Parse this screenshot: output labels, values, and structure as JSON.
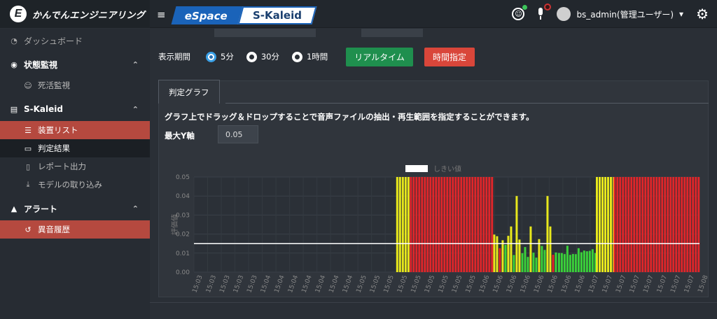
{
  "brand": {
    "logo_letter": "E",
    "name": "かんでんエンジニアリング"
  },
  "header": {
    "hamburger_glyph": "≡",
    "product_left": "eSpace",
    "product_right": "S-Kaleid",
    "smile_glyph": "☺",
    "user_name": "bs_admin(管理ユーザー)",
    "user_caret": "▾",
    "gear_glyph": "⚙"
  },
  "sidebar": {
    "dashboard": "ダッシュボード",
    "status_section": "状態監視",
    "status_items": [
      "死活監視"
    ],
    "skaleid_section": "S-Kaleid",
    "skaleid_items": [
      "装置リスト",
      "判定結果",
      "レポート出力",
      "モデルの取り込み"
    ],
    "alert_section": "アラート",
    "alert_items": [
      "異音履歴"
    ]
  },
  "controls": {
    "period_label": "表示期間",
    "options": [
      "5分",
      "30分",
      "1時間"
    ],
    "selected": "5分",
    "realtime_button": "リアルタイム",
    "time_button": "時間指定"
  },
  "panel": {
    "tab_label": "判定グラフ",
    "instruction": "グラフ上でドラッグ＆ドロップすることで音声ファイルの抽出・再生範囲を指定することができます。",
    "ymax_label": "最大Y軸",
    "ymax_value": "0.05"
  },
  "colors": {
    "red": "#e0262a",
    "yellow": "#e8e81c",
    "green": "#3ad13a",
    "threshold": "#ffffff"
  },
  "chart_data": {
    "type": "bar",
    "legend": [
      "しきい値"
    ],
    "ylabel": "評価値",
    "ylim": [
      0,
      0.05
    ],
    "yticks": [
      "0.05",
      "0.04",
      "0.03",
      "0.02",
      "0.01",
      "0.00"
    ],
    "threshold": 0.015,
    "xticks": [
      "15:03",
      "15:03",
      "15:03",
      "15:03",
      "15:03",
      "15:04",
      "15:04",
      "15:04",
      "15:04",
      "15:04",
      "15:04",
      "15:04",
      "15:05",
      "15:05",
      "15:05",
      "15:05",
      "15:05",
      "15:05",
      "15:05",
      "15:05",
      "15:05",
      "15:06",
      "15:06",
      "15:06",
      "15:06",
      "15:06",
      "15:06",
      "15:06",
      "15:06",
      "15:07",
      "15:07",
      "15:07",
      "15:07",
      "15:07",
      "15:07",
      "15:07",
      "15:07",
      "15:08"
    ],
    "segments": [
      {
        "from": 0.4,
        "to": 0.427,
        "color": "yellow",
        "value": 0.05
      },
      {
        "from": 0.427,
        "to": 0.592,
        "color": "red",
        "value": 0.05
      },
      {
        "from": 0.592,
        "to": 0.72,
        "color": "mixed",
        "value": 0.016
      },
      {
        "from": 0.72,
        "to": 0.795,
        "color": "green",
        "value": 0.011
      },
      {
        "from": 0.795,
        "to": 0.83,
        "color": "yellow",
        "value": 0.05
      },
      {
        "from": 0.83,
        "to": 1.0,
        "color": "red",
        "value": 0.05
      }
    ]
  }
}
